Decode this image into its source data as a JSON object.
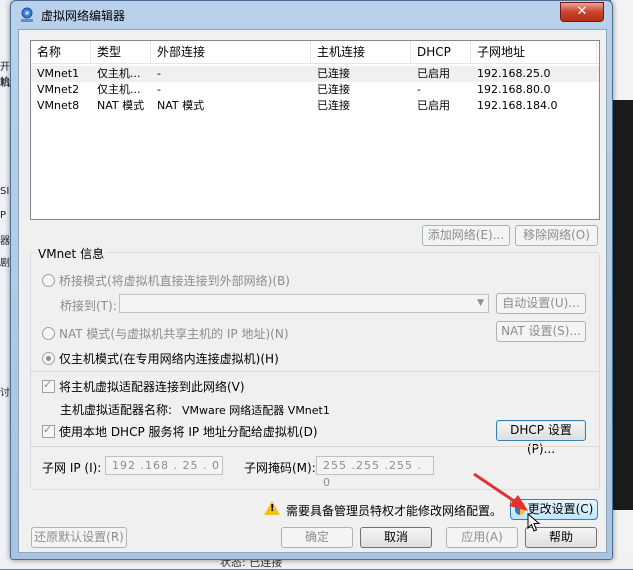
{
  "window": {
    "title": "虚拟网络编辑器",
    "close": "✕"
  },
  "table": {
    "headers": [
      "名称",
      "类型",
      "外部连接",
      "主机连接",
      "DHCP",
      "子网地址"
    ],
    "rows": [
      [
        "VMnet1",
        "仅主机...",
        "-",
        "已连接",
        "已启用",
        "192.168.25.0"
      ],
      [
        "VMnet2",
        "仅主机...",
        "-",
        "已连接",
        "-",
        "192.168.80.0"
      ],
      [
        "VMnet8",
        "NAT 模式",
        "NAT 模式",
        "已连接",
        "已启用",
        "192.168.184.0"
      ]
    ]
  },
  "buttons": {
    "add_network": "添加网络(E)...",
    "remove_network": "移除网络(O)",
    "auto_settings": "自动设置(U)...",
    "nat_settings": "NAT 设置(S)...",
    "dhcp_settings": "DHCP 设置(P)...",
    "change_settings": "更改设置(C)",
    "restore_defaults": "还原默认设置(R)",
    "ok": "确定",
    "cancel": "取消",
    "apply": "应用(A)",
    "help": "帮助"
  },
  "vmnet_info": {
    "title": "VMnet 信息",
    "bridged": "桥接模式(将虚拟机直接连接到外部网络)(B)",
    "bridged_to": "桥接到(T):",
    "nat": "NAT 模式(与虚拟机共享主机的 IP 地址)(N)",
    "host_only": "仅主机模式(在专用网络内连接虚拟机)(H)",
    "connect_adapter": "将主机虚拟适配器连接到此网络(V)",
    "adapter_name_label": "主机虚拟适配器名称:",
    "adapter_name": "VMware 网络适配器 VMnet1",
    "use_dhcp": "使用本地 DHCP 服务将 IP 地址分配给虚拟机(D)",
    "subnet_ip_label": "子网 IP (I):",
    "subnet_ip": "192 .168 . 25  . 0",
    "subnet_mask_label": "子网掩码(M):",
    "subnet_mask": "255 .255 .255 . 0"
  },
  "warning": "需要具备管理员特权才能修改网络配置。",
  "background": {
    "left_fragments": [
      "开始",
      "机",
      "SI)",
      "P (",
      "器",
      "剧",
      "讨"
    ],
    "bottom_text": "状态: 已连接"
  },
  "colors": {
    "annotation_arrow": "#e53030",
    "accent": "#3c7fb1"
  },
  "icons": {
    "app": "vmware-network-icon",
    "warning": "warning-triangle-icon",
    "shield": "uac-shield-icon"
  }
}
